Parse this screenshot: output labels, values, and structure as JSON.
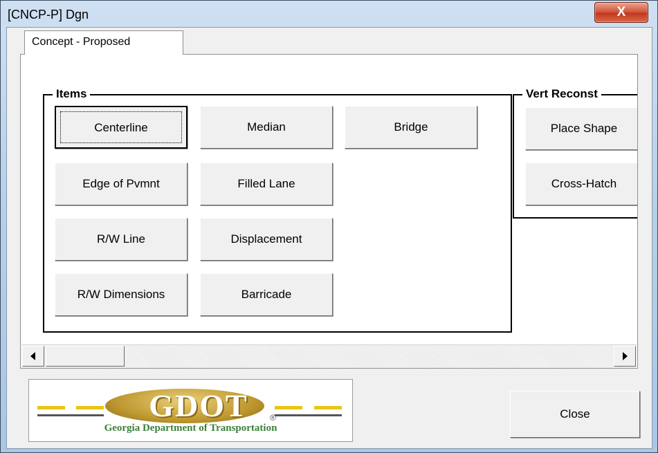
{
  "window": {
    "title": "[CNCP-P] Dgn",
    "close_glyph": "X"
  },
  "tabs": [
    {
      "label": "Concept - Proposed",
      "selected": true
    }
  ],
  "items_group": {
    "label": "Items",
    "buttons": [
      "Centerline",
      "Median",
      "Bridge",
      "Edge of Pvmnt",
      "Filled Lane",
      "R/W Line",
      "Displacement",
      "R/W Dimensions",
      "Barricade"
    ]
  },
  "vert_group": {
    "label": "Vert Reconst",
    "buttons": [
      "Place Shape",
      "Cross-Hatch"
    ]
  },
  "logo": {
    "wordmark": "GDOT",
    "registered": "®",
    "caption": "Georgia Department of Transportation",
    "colors": {
      "gold": "#c9a02c",
      "green": "#3c7f3c",
      "yellow": "#e8c513"
    }
  },
  "footer": {
    "close_label": "Close"
  },
  "scrollbar": {
    "left_icon": "arrow-left-icon",
    "right_icon": "arrow-right-icon"
  }
}
